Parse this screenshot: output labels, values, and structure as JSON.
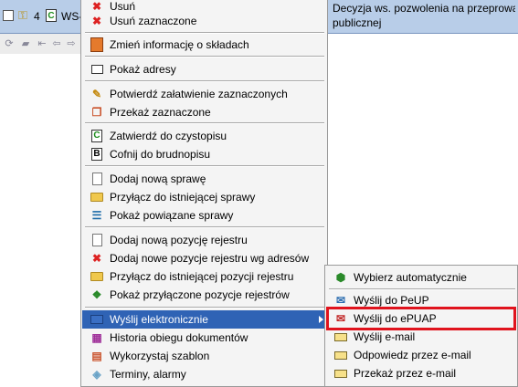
{
  "grid": {
    "row_number": "4",
    "ws_text": "WS-",
    "description_line1": "Decyzja ws. pozwolenia na przeprowa",
    "description_line2": "publicznej"
  },
  "context_menu": {
    "items": [
      {
        "label": "Usuń",
        "icon": "delete-icon"
      },
      {
        "label": "Usuń zaznaczone",
        "icon": "delete-selected-icon"
      },
      {
        "label": "Zmień informację o składach",
        "icon": "edit-info-icon"
      },
      {
        "label": "Pokaż adresy",
        "icon": "address-card-icon"
      },
      {
        "label": "Potwierdź załatwienie zaznaczonych",
        "icon": "confirm-icon"
      },
      {
        "label": "Przekaż zaznaczone",
        "icon": "forward-icon"
      },
      {
        "label": "Zatwierdź do czystopisu",
        "icon": "approve-letter-icon"
      },
      {
        "label": "Cofnij do brudnopisu",
        "icon": "revert-letter-icon"
      },
      {
        "label": "Dodaj nową sprawę",
        "icon": "new-document-icon"
      },
      {
        "label": "Przyłącz do istniejącej sprawy",
        "icon": "folder-icon"
      },
      {
        "label": "Pokaż powiązane sprawy",
        "icon": "related-cases-icon"
      },
      {
        "label": "Dodaj nową pozycję rejestru",
        "icon": "new-register-icon"
      },
      {
        "label": "Dodaj nowe pozycje rejestru wg adresów",
        "icon": "register-by-address-icon"
      },
      {
        "label": "Przyłącz do istniejącej pozycji rejestru",
        "icon": "folder-icon"
      },
      {
        "label": "Pokaż przyłączone pozycje rejestrów",
        "icon": "linked-registers-icon"
      },
      {
        "label": "Wyślij elektronicznie",
        "icon": "send-electronic-icon"
      },
      {
        "label": "Historia obiegu dokumentów",
        "icon": "history-icon"
      },
      {
        "label": "Wykorzystaj szablon",
        "icon": "template-icon"
      },
      {
        "label": "Terminy, alarmy",
        "icon": "alarm-icon"
      }
    ]
  },
  "submenu": {
    "items": [
      {
        "label": "Wybierz automatycznie",
        "icon": "auto-select-icon"
      },
      {
        "label": "Wyślij do PeUP",
        "icon": "send-peup-icon"
      },
      {
        "label": "Wyślij do ePUAP",
        "icon": "send-epuap-icon"
      },
      {
        "label": "Wyślij e-mail",
        "icon": "email-icon"
      },
      {
        "label": "Odpowiedz przez e-mail",
        "icon": "reply-email-icon"
      },
      {
        "label": "Przekaż przez e-mail",
        "icon": "forward-email-icon"
      }
    ]
  },
  "colors": {
    "menu_highlight": "#2f63b5",
    "callout_border": "#e0131d",
    "grid_row": "#b8cde8"
  }
}
